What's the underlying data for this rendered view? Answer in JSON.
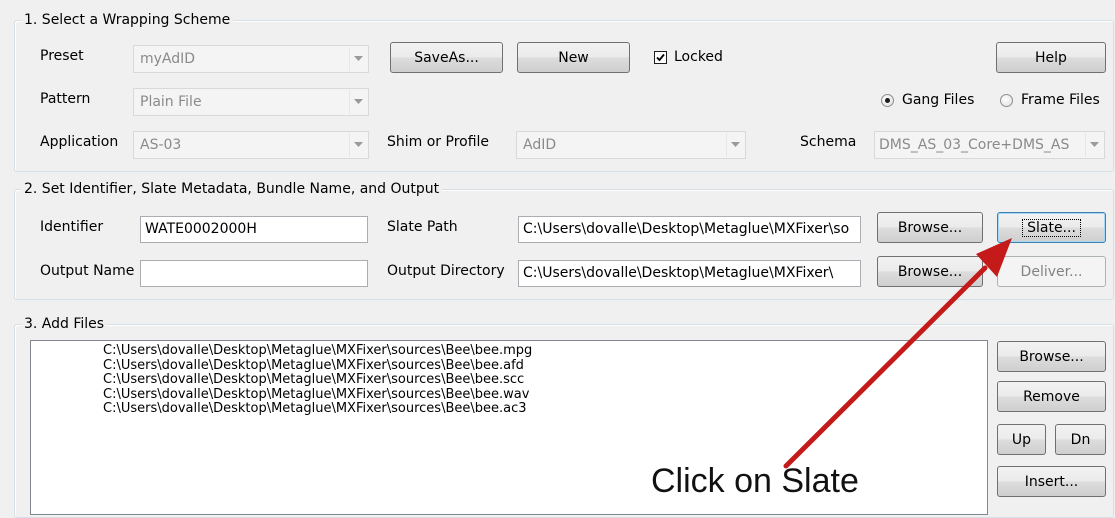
{
  "section1": {
    "legend": "1. Select a Wrapping Scheme",
    "preset_label": "Preset",
    "preset_value": "myAdID",
    "saveas_button": "SaveAs...",
    "new_button": "New",
    "locked_label": "Locked",
    "locked_checked": true,
    "help_button": "Help",
    "pattern_label": "Pattern",
    "pattern_value": "Plain File",
    "gang_files_label": "Gang Files",
    "frame_files_label": "Frame Files",
    "selected_mode": "Gang Files",
    "application_label": "Application",
    "application_value": "AS-03",
    "shim_label": "Shim or Profile",
    "shim_value": "AdID",
    "schema_label": "Schema",
    "schema_value": "DMS_AS_03_Core+DMS_AS"
  },
  "section2": {
    "legend": "2. Set Identifier, Slate Metadata, Bundle Name, and Output",
    "identifier_label": "Identifier",
    "identifier_value": "WATE0002000H",
    "slate_path_label": "Slate Path",
    "slate_path_value": "C:\\Users\\dovalle\\Desktop\\Metaglue\\MXFixer\\so",
    "browse_button_1": "Browse...",
    "slate_button": "Slate...",
    "output_name_label": "Output Name",
    "output_name_value": "",
    "output_dir_label": "Output Directory",
    "output_dir_value": "C:\\Users\\dovalle\\Desktop\\Metaglue\\MXFixer\\",
    "browse_button_2": "Browse...",
    "deliver_button": "Deliver..."
  },
  "section3": {
    "legend": "3. Add Files",
    "files": [
      "C:\\Users\\dovalle\\Desktop\\Metaglue\\MXFixer\\sources\\Bee\\bee.mpg",
      "C:\\Users\\dovalle\\Desktop\\Metaglue\\MXFixer\\sources\\Bee\\bee.afd",
      "C:\\Users\\dovalle\\Desktop\\Metaglue\\MXFixer\\sources\\Bee\\bee.scc",
      "C:\\Users\\dovalle\\Desktop\\Metaglue\\MXFixer\\sources\\Bee\\bee.wav",
      "C:\\Users\\dovalle\\Desktop\\Metaglue\\MXFixer\\sources\\Bee\\bee.ac3"
    ],
    "browse_button": "Browse...",
    "remove_button": "Remove",
    "up_button": "Up",
    "down_button": "Dn",
    "insert_button": "Insert..."
  },
  "annotation": {
    "text": "Click on Slate",
    "arrow_color": "#c41a1a"
  },
  "icons": {
    "dropdown": "chevron-down-icon",
    "checkbox": "checkmark-icon"
  }
}
